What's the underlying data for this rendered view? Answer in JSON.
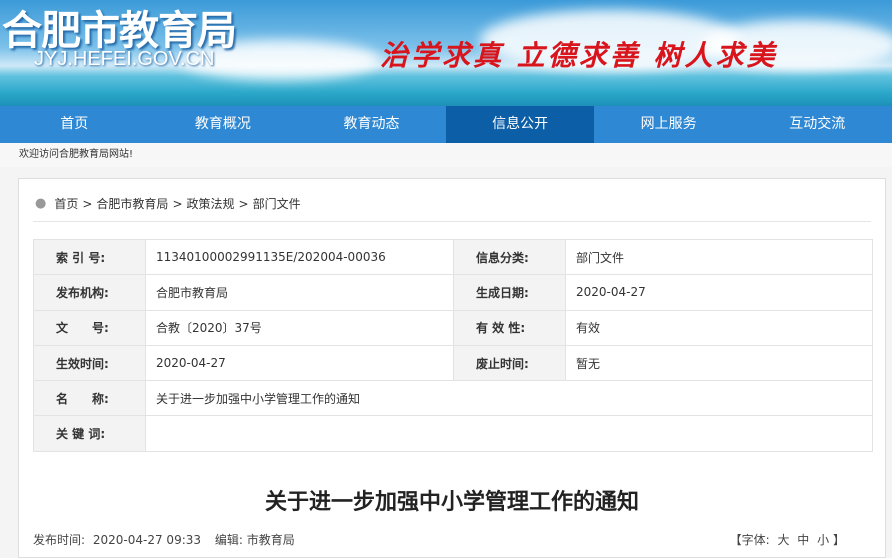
{
  "header": {
    "logo": "合肥市教育局",
    "domain": "JYJ.HEFEI.GOV.CN",
    "slogan": "治学求真 立德求善 树人求美"
  },
  "nav": [
    {
      "label": "首页"
    },
    {
      "label": "教育概况"
    },
    {
      "label": "教育动态"
    },
    {
      "label": "信息公开",
      "active": true
    },
    {
      "label": "网上服务"
    },
    {
      "label": "互动交流"
    }
  ],
  "welcome": "欢迎访问合肥教育局网站!",
  "breadcrumb": [
    "首页",
    "合肥市教育局",
    "政策法规",
    "部门文件"
  ],
  "info": {
    "index_label": "索 引 号:",
    "index": "11340100002991135E/202004-00036",
    "category_label": "信息分类:",
    "category": "部门文件",
    "publisher_label": "发布机构:",
    "publisher": "合肥市教育局",
    "created_label": "生成日期:",
    "created": "2020-04-27",
    "docno_label": "文　　号:",
    "docno": "合教〔2020〕37号",
    "validity_label": "有 效 性:",
    "validity": "有效",
    "effective_label": "生效时间:",
    "effective": "2020-04-27",
    "abolish_label": "废止时间:",
    "abolish": "暂无",
    "name_label": "名　　称:",
    "name": "关于进一步加强中小学管理工作的通知",
    "keywords_label": "关 键 词:",
    "keywords": ""
  },
  "article": {
    "title": "关于进一步加强中小学管理工作的通知",
    "publish_label": "发布时间:",
    "publish_time": "2020-04-27 09:33",
    "editor_label": "编辑:",
    "editor": "市教育局",
    "font_open": "【字体:",
    "font_large": "大",
    "font_medium": "中",
    "font_small": "小",
    "font_close": "】"
  }
}
